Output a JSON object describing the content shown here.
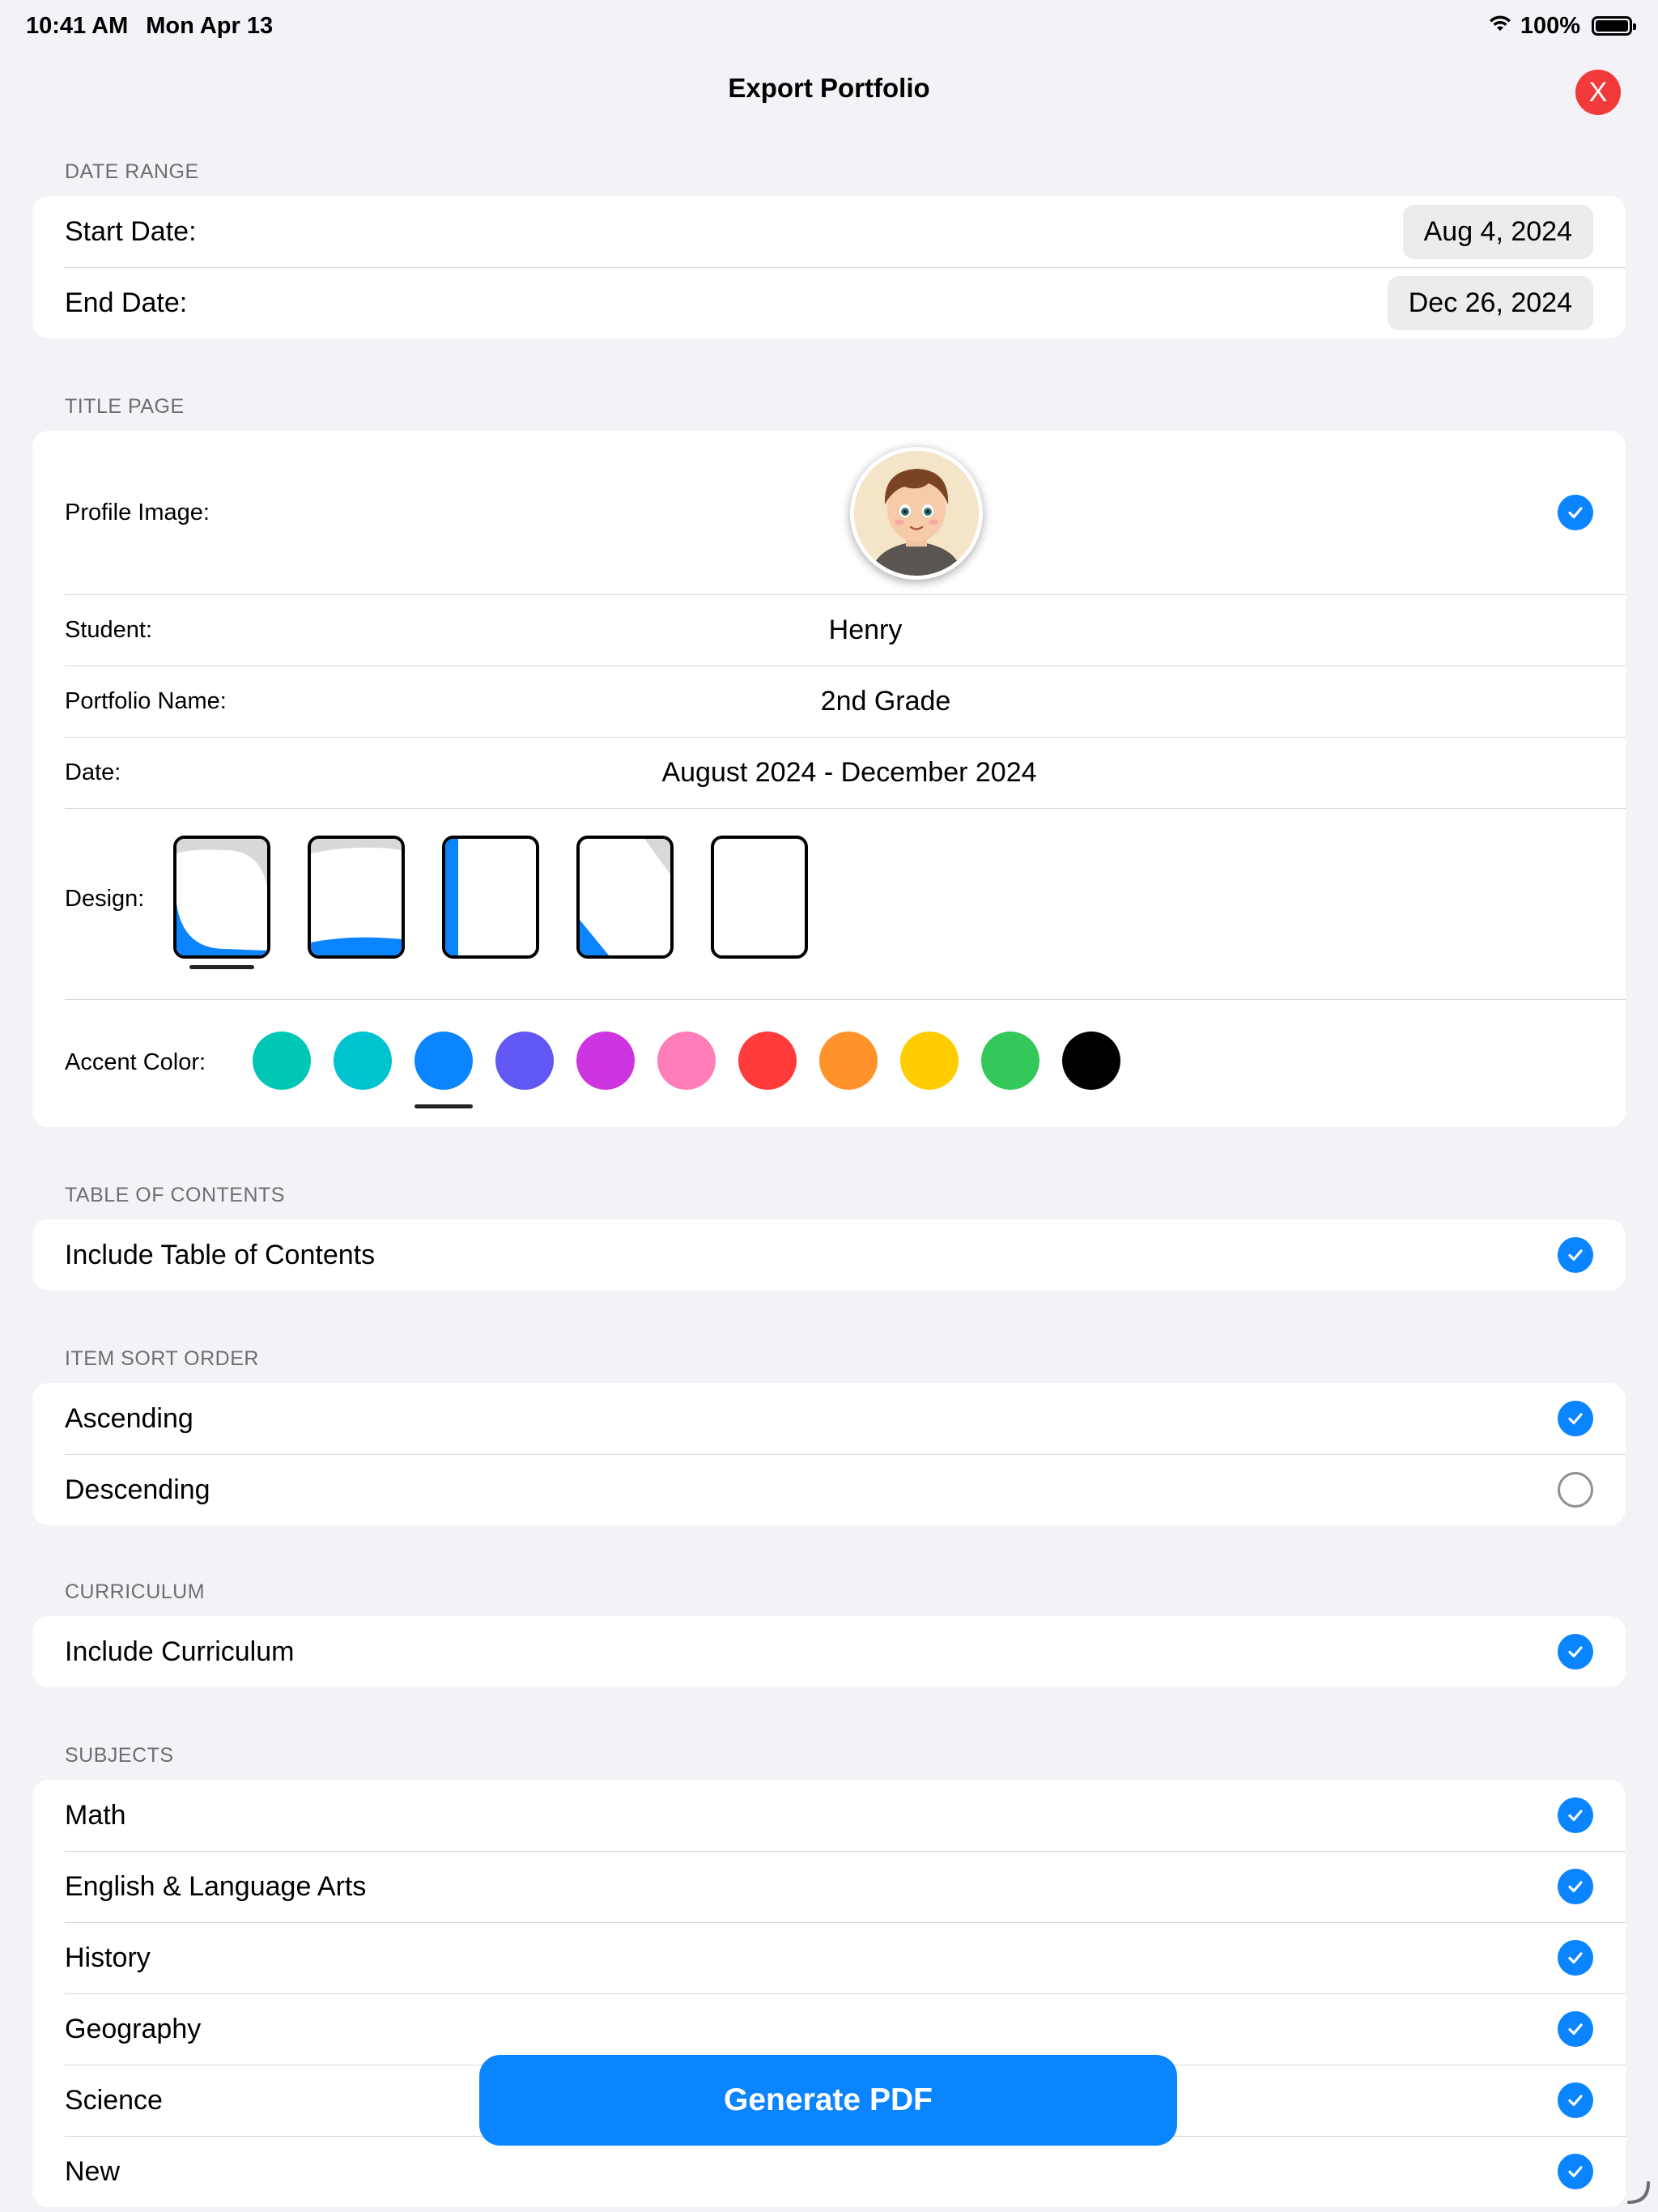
{
  "status_bar": {
    "time": "10:41 AM",
    "date": "Mon Apr 13",
    "battery": "100%"
  },
  "nav": {
    "title": "Export Portfolio",
    "close_label": "X"
  },
  "date_range": {
    "header": "DATE RANGE",
    "start_label": "Start Date:",
    "start_value": "Aug 4, 2024",
    "end_label": "End Date:",
    "end_value": "Dec 26, 2024"
  },
  "title_page": {
    "header": "TITLE PAGE",
    "profile_image_label": "Profile Image:",
    "profile_image_checked": true,
    "student_label": "Student:",
    "student_value": "Henry",
    "portfolio_name_label": "Portfolio Name:",
    "portfolio_name_value": "2nd Grade",
    "date_label": "Date:",
    "date_value": "August 2024 - December 2024",
    "design_label": "Design:",
    "designs": [
      "corner-wave",
      "bottom-wave",
      "side-bar",
      "diagonal-corner",
      "plain"
    ],
    "selected_design": 0,
    "accent_label": "Accent Color:",
    "accent_colors": [
      "#00c7b4",
      "#00c3d0",
      "#0a84ff",
      "#6157f5",
      "#cc35e0",
      "#ff7eb9",
      "#ff3b3b",
      "#ff922b",
      "#ffcc00",
      "#34c759",
      "#000000"
    ],
    "selected_accent": 2
  },
  "table_of_contents": {
    "header": "TABLE OF CONTENTS",
    "include_label": "Include Table of Contents",
    "checked": true
  },
  "sort_order": {
    "header": "ITEM SORT ORDER",
    "options": [
      {
        "label": "Ascending",
        "checked": true
      },
      {
        "label": "Descending",
        "checked": false
      }
    ]
  },
  "curriculum": {
    "header": "CURRICULUM",
    "include_label": "Include Curriculum",
    "checked": true
  },
  "subjects": {
    "header": "SUBJECTS",
    "items": [
      {
        "label": "Math",
        "checked": true
      },
      {
        "label": "English & Language Arts",
        "checked": true
      },
      {
        "label": "History",
        "checked": true
      },
      {
        "label": "Geography",
        "checked": true
      },
      {
        "label": "Science",
        "checked": true
      },
      {
        "label": "New",
        "checked": true
      }
    ]
  },
  "actions": {
    "generate_label": "Generate PDF"
  }
}
